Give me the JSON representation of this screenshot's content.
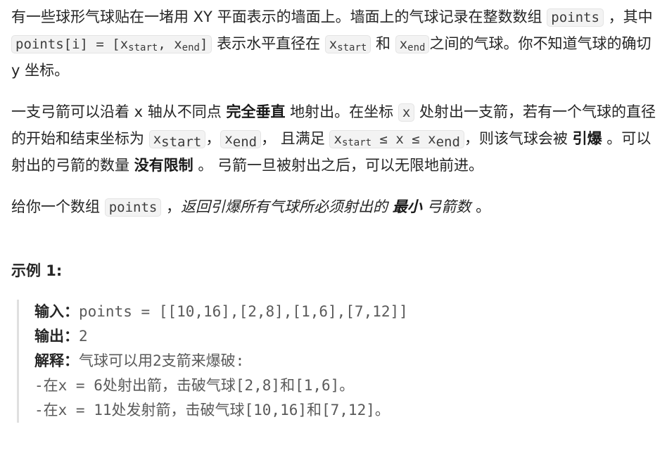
{
  "p1": {
    "t1": "有一些球形气球贴在一堵用 XY 平面表示的墙面上。墙面上的气球记录在整数数组 ",
    "c1": "points",
    "t2": " ，其中",
    "c2": "points[i] = [x",
    "c2_sub1": "start",
    "c2_mid": ", x",
    "c2_sub2": "end",
    "c2_end": "]",
    "t3": " 表示水平直径在 ",
    "c3": "x",
    "c3_sub": "start",
    "t4": " 和 ",
    "c4": "x",
    "c4_sub": "end",
    "t5": "之间的气球。你不知道气球的确切 y 坐标。"
  },
  "p2": {
    "t1": "一支弓箭可以沿着 x 轴从不同点 ",
    "b1": "完全垂直",
    "t2": " 地射出。在坐标 ",
    "c1": "x",
    "t3": " 处射出一支箭，若有一个气球的直径的开始和结束坐标为 ",
    "c2": "x",
    "c2_sub": "start",
    "t4": "，",
    "c3": "x",
    "c3_sub": "end",
    "t5": "， 且满足  ",
    "c4": "x",
    "c4_sub1": "start",
    "c4_mid": " ≤ x ≤ x",
    "c4_sub2": "end",
    "t6": "，则该气球会被 ",
    "b2": "引爆",
    "t7": " 。可以射出的弓箭的数量 ",
    "b3": "没有限制",
    "t8": " 。 弓箭一旦被射出之后，可以无限地前进。"
  },
  "p3": {
    "t1": "给你一个数组 ",
    "c1": "points",
    "t2": " ，",
    "e1": "返回引爆所有气球所必须射出的 ",
    "b1": "最小",
    "e2": " 弓箭数 ",
    "t3": "。"
  },
  "example": {
    "title": "示例 1:",
    "input_label": "输入：",
    "input_value": "points = [[10,16],[2,8],[1,6],[7,12]]",
    "output_label": "输出：",
    "output_value": "2",
    "explain_label": "解释：",
    "explain_value": "气球可以用2支箭来爆破:",
    "line1": "-在x = 6处射出箭，击破气球[2,8]和[1,6]。",
    "line2": "-在x = 11处发射箭，击破气球[10,16]和[7,12]。"
  }
}
